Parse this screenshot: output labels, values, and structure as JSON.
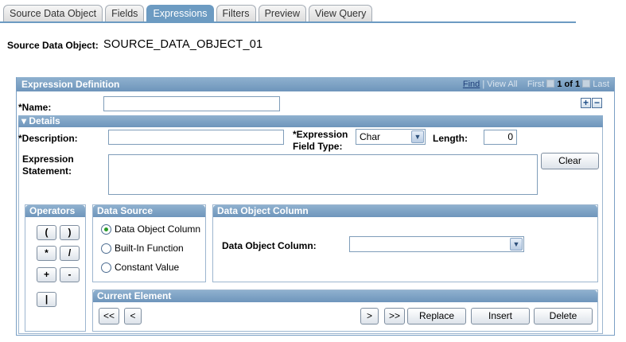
{
  "tabs": [
    {
      "label": "Source Data Object",
      "active": false
    },
    {
      "label": "Fields",
      "active": false
    },
    {
      "label": "Expressions",
      "active": true
    },
    {
      "label": "Filters",
      "active": false
    },
    {
      "label": "Preview",
      "active": false
    },
    {
      "label": "View Query",
      "active": false
    }
  ],
  "source_data_object": {
    "label": "Source Data Object:",
    "value": "SOURCE_DATA_OBJECT_01"
  },
  "expression_definition": {
    "title": "Expression Definition",
    "nav": {
      "find": "Find",
      "view_all": "View All",
      "first": "First",
      "count": "1 of 1",
      "last": "Last"
    },
    "name_label": "*Name:",
    "name_value": "",
    "add_label": "+",
    "remove_label": "−"
  },
  "details": {
    "title": "Details",
    "description_label": "*Description:",
    "description_value": "",
    "field_type_label_1": "*Expression",
    "field_type_label_2": "Field Type:",
    "field_type_value": "Char",
    "length_label": "Length:",
    "length_value": "0",
    "statement_label_1": "Expression",
    "statement_label_2": "Statement:",
    "statement_value": "",
    "clear_label": "Clear"
  },
  "operators": {
    "title": "Operators",
    "buttons": [
      "(",
      ")",
      "*",
      "/",
      "+",
      "-",
      "|"
    ]
  },
  "data_source": {
    "title": "Data Source",
    "options": [
      {
        "label": "Data Object Column",
        "selected": true
      },
      {
        "label": "Built-In Function",
        "selected": false
      },
      {
        "label": "Constant Value",
        "selected": false
      }
    ]
  },
  "data_object_column": {
    "title": "Data Object Column",
    "field_label": "Data Object Column:",
    "field_value": ""
  },
  "current_element": {
    "title": "Current Element",
    "first_label": "<<",
    "prev_label": "<",
    "next_label": ">",
    "last_label": ">>",
    "replace_label": "Replace",
    "insert_label": "Insert",
    "delete_label": "Delete"
  },
  "colors": {
    "accent": "#6c9bc2",
    "header": "#7fa3c6",
    "radio_dot": "#2a9a2a"
  }
}
